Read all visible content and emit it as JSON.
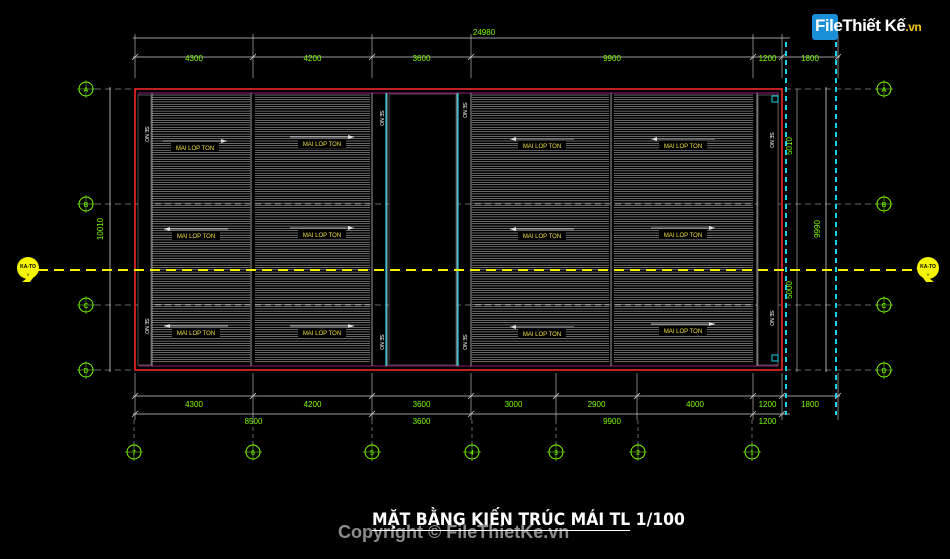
{
  "logo": {
    "part1": "File",
    "part2": "Thiết Kế",
    "part3": ".vn"
  },
  "title": "MẶT BẰNG KIẾN TRÚC MÁI TL 1/100",
  "copyright": "Copyright © FileThietKe.vn",
  "dims": {
    "overall": "24980",
    "top": [
      "4300",
      "4200",
      "3600",
      "9900",
      "1200",
      "1800"
    ],
    "bottom1": [
      "4300",
      "4200",
      "3600",
      "3000",
      "2900",
      "4000",
      "1200",
      "1800"
    ],
    "bottom2": [
      "8500",
      "3600",
      "9900",
      "1200"
    ],
    "left": "10010",
    "right": "9990",
    "right_inner": [
      "5010",
      "5000"
    ]
  },
  "grid_letters": [
    "A",
    "B",
    "C",
    "D"
  ],
  "grid_numbers": [
    "7",
    "6",
    "5",
    "4",
    "3",
    "2",
    "1"
  ],
  "roof_label": "MAI LOP TON",
  "gutter_label": "SE NO",
  "section_label": "KA-TO",
  "colors": {
    "bg": "#000000",
    "dim": "#d0d0d0",
    "dimtext": "#7cfc00",
    "grid": "#7cfc00",
    "outline": "#ff2a2a",
    "section": "#f5f500",
    "cyan": "#19d3e6",
    "roof": "#cfcfcf"
  }
}
